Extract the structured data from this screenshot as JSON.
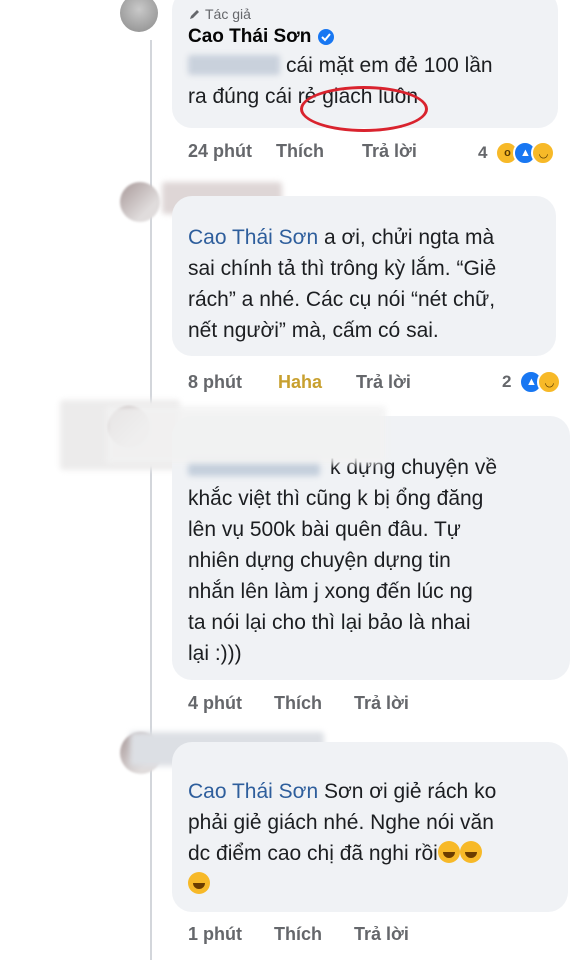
{
  "comments": [
    {
      "author_tag": "Tác giả",
      "author": "Cao Thái Sơn",
      "text_line1": "cái mặt em đẻ 100 lần",
      "text_line2_a": "ra đúng cái ",
      "text_line2_b": "rẻ giách",
      "text_line2_c": " luôn",
      "time": "24 phút",
      "like": "Thích",
      "reply": "Trả lời",
      "reaction_count": "4"
    },
    {
      "mention": "Cao Thái Sơn",
      "text_after_mention": " a ơi, chửi ngta mà",
      "text_lines": [
        "sai chính tả thì trông kỳ lắm. “Giẻ",
        "rách” a nhé. Các cụ nói “nét chữ,",
        "nết người” mà, cấm có sai."
      ],
      "time": "8 phút",
      "like": "Haha",
      "reply": "Trả lời",
      "reaction_count": "2"
    },
    {
      "first_line_rest": "k dựng chuyện về",
      "text_lines": [
        "khắc việt thì cũng k bị ổng đăng",
        "lên vụ 500k bài quên đâu. Tự",
        "nhiên dựng chuyện dựng tin",
        "nhắn lên làm j xong đến lúc ng",
        "ta nói lại cho thì lại bảo là nhai",
        "lại :)))"
      ],
      "time": "4 phút",
      "like": "Thích",
      "reply": "Trả lời"
    },
    {
      "mention": "Cao Thái Sơn",
      "text_after_mention": " Sơn ơi giẻ rách ko",
      "text_lines": [
        "phải giẻ giách nhé. Nghe nói văn",
        "dc điểm cao chị đã nghi rồi"
      ],
      "time": "1 phút",
      "like": "Thích",
      "reply": "Trả lời"
    }
  ],
  "colors": {
    "bubble": "#f0f2f5",
    "mention": "#2e5e9c",
    "highlight_oval": "#d9232e",
    "haha": "#c8a02f",
    "meta": "#65676b"
  }
}
